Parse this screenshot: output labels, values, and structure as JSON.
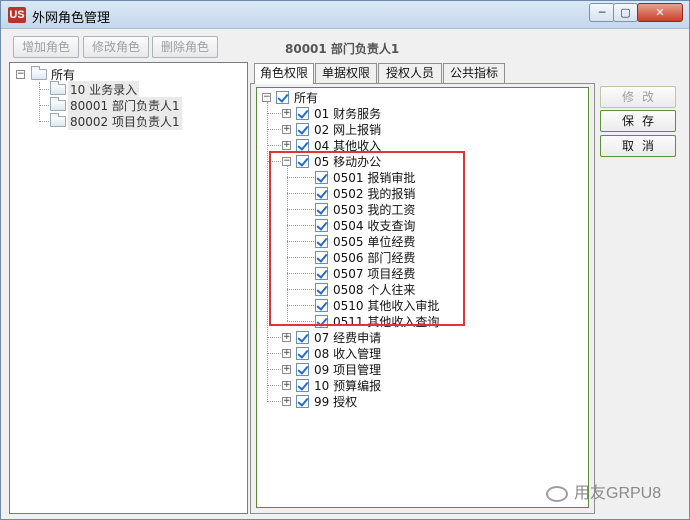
{
  "window": {
    "title": "外网角色管理",
    "icon_text": "US",
    "controls": {
      "minimize": "─",
      "maximize": "▢",
      "close": "✕"
    }
  },
  "toolbar": {
    "add_label": "增加角色",
    "edit_label": "修改角色",
    "delete_label": "删除角色",
    "current_role": "80001  部门负责人1"
  },
  "left_tree": {
    "root": "所有",
    "items": [
      {
        "label": "10  业务录入"
      },
      {
        "label": "80001  部门负责人1"
      },
      {
        "label": "80002  项目负责人1"
      }
    ]
  },
  "tabs": [
    {
      "label": "角色权限",
      "active": true
    },
    {
      "label": "单据权限",
      "active": false
    },
    {
      "label": "授权人员",
      "active": false
    },
    {
      "label": "公共指标",
      "active": false
    }
  ],
  "perm_tree": {
    "root": "所有",
    "nodes": [
      {
        "label": "01  财务服务",
        "level": 1,
        "expander": "+"
      },
      {
        "label": "02  网上报销",
        "level": 1,
        "expander": "+"
      },
      {
        "label": "04  其他收入",
        "level": 1,
        "expander": "+"
      },
      {
        "label": "05  移动办公",
        "level": 1,
        "expander": "−"
      },
      {
        "label": "0501  报销审批",
        "level": 2
      },
      {
        "label": "0502  我的报销",
        "level": 2
      },
      {
        "label": "0503  我的工资",
        "level": 2
      },
      {
        "label": "0504  收支查询",
        "level": 2
      },
      {
        "label": "0505  单位经费",
        "level": 2
      },
      {
        "label": "0506  部门经费",
        "level": 2
      },
      {
        "label": "0507  项目经费",
        "level": 2
      },
      {
        "label": "0508  个人往来",
        "level": 2
      },
      {
        "label": "0510  其他收入审批",
        "level": 2
      },
      {
        "label": "0511  其他收入查询",
        "level": 2
      },
      {
        "label": "07  经费申请",
        "level": 1,
        "expander": "+"
      },
      {
        "label": "08  收入管理",
        "level": 1,
        "expander": "+"
      },
      {
        "label": "09  项目管理",
        "level": 1,
        "expander": "+"
      },
      {
        "label": "10  预算编报",
        "level": 1,
        "expander": "+"
      },
      {
        "label": "99  授权",
        "level": 1,
        "expander": "+"
      }
    ]
  },
  "side_buttons": {
    "modify": "修改",
    "save": "保存",
    "cancel": "取消"
  },
  "watermark": "用友GRPU8",
  "colors": {
    "highlight": "#d8383a",
    "accent_border": "#5c8a3a",
    "check": "#1f6fc7"
  }
}
